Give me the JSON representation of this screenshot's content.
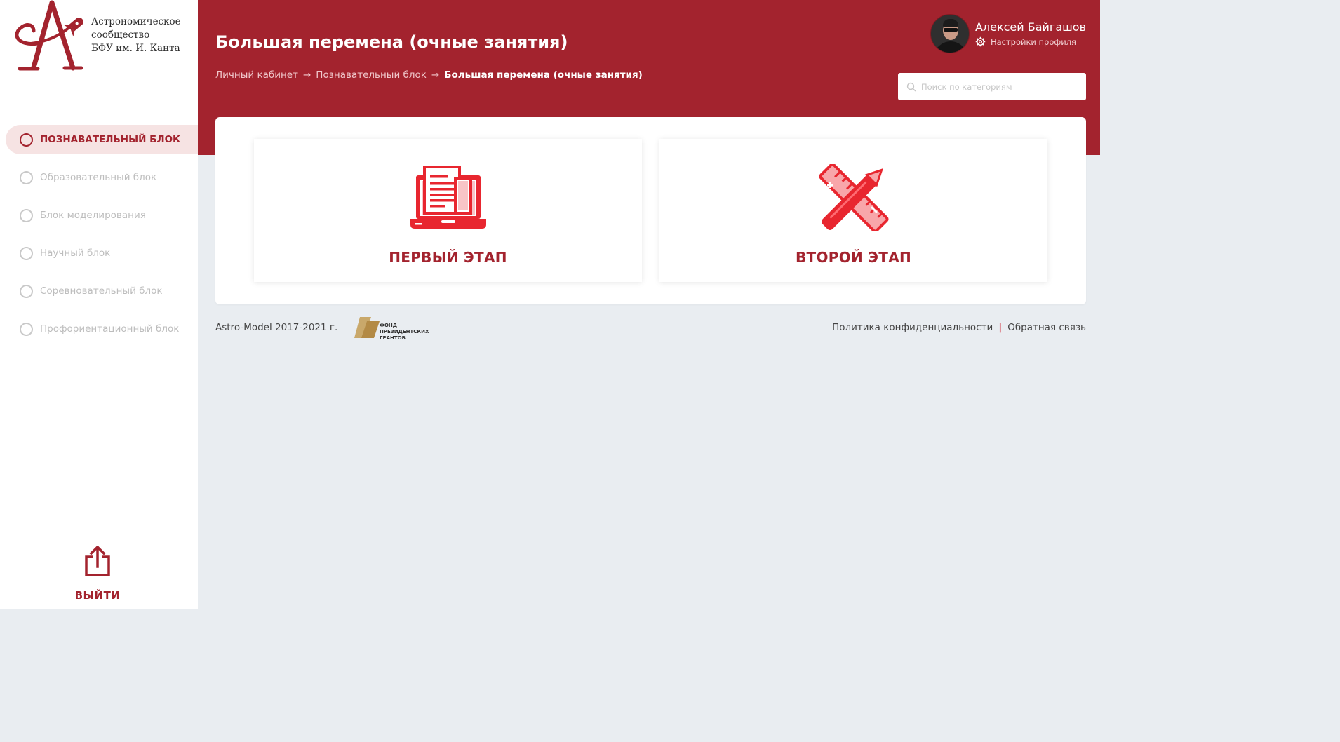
{
  "brand": {
    "org_line1": "Астрономическое",
    "org_line2": "сообщество",
    "org_line3": "БФУ им. И. Канта"
  },
  "sidebar": {
    "items": [
      {
        "label": "ПОЗНАВАТЕЛЬНЫЙ БЛОК",
        "active": true
      },
      {
        "label": "Образовательный блок",
        "active": false
      },
      {
        "label": "Блок моделирования",
        "active": false
      },
      {
        "label": "Научный блок",
        "active": false
      },
      {
        "label": "Соревновательный блок",
        "active": false
      },
      {
        "label": "Профориентационный блок",
        "active": false
      }
    ],
    "logout_label": "ВЫЙТИ"
  },
  "header": {
    "title": "Большая перемена (очные занятия)",
    "breadcrumb": [
      {
        "label": "Личный кабинет"
      },
      {
        "label": "Познавательный блок"
      },
      {
        "label": "Большая перемена (очные занятия)"
      }
    ],
    "separator": "→"
  },
  "profile": {
    "name": "Алексей Байгашов",
    "settings_label": "Настройки профиля"
  },
  "search": {
    "placeholder": "Поиск по категориям",
    "value": ""
  },
  "cards": [
    {
      "label": "ПЕРВЫЙ ЭТАП",
      "icon": "laptop-document-icon"
    },
    {
      "label": "ВТОРОЙ ЭТАП",
      "icon": "ruler-pencil-icon"
    }
  ],
  "footer": {
    "copyright": "Astro-Model 2017-2021 г.",
    "fund_line1": "ФОНД",
    "fund_line2": "ПРЕЗИДЕНТСКИХ",
    "fund_line3": "ГРАНТОВ",
    "privacy_label": "Политика конфиденциальности",
    "feedback_label": "Обратная связь"
  },
  "colors": {
    "brand_red": "#a3232e",
    "icon_red": "#e8262f",
    "page_bg": "#e9edf1",
    "active_nav_bg": "#f6e3e3"
  }
}
